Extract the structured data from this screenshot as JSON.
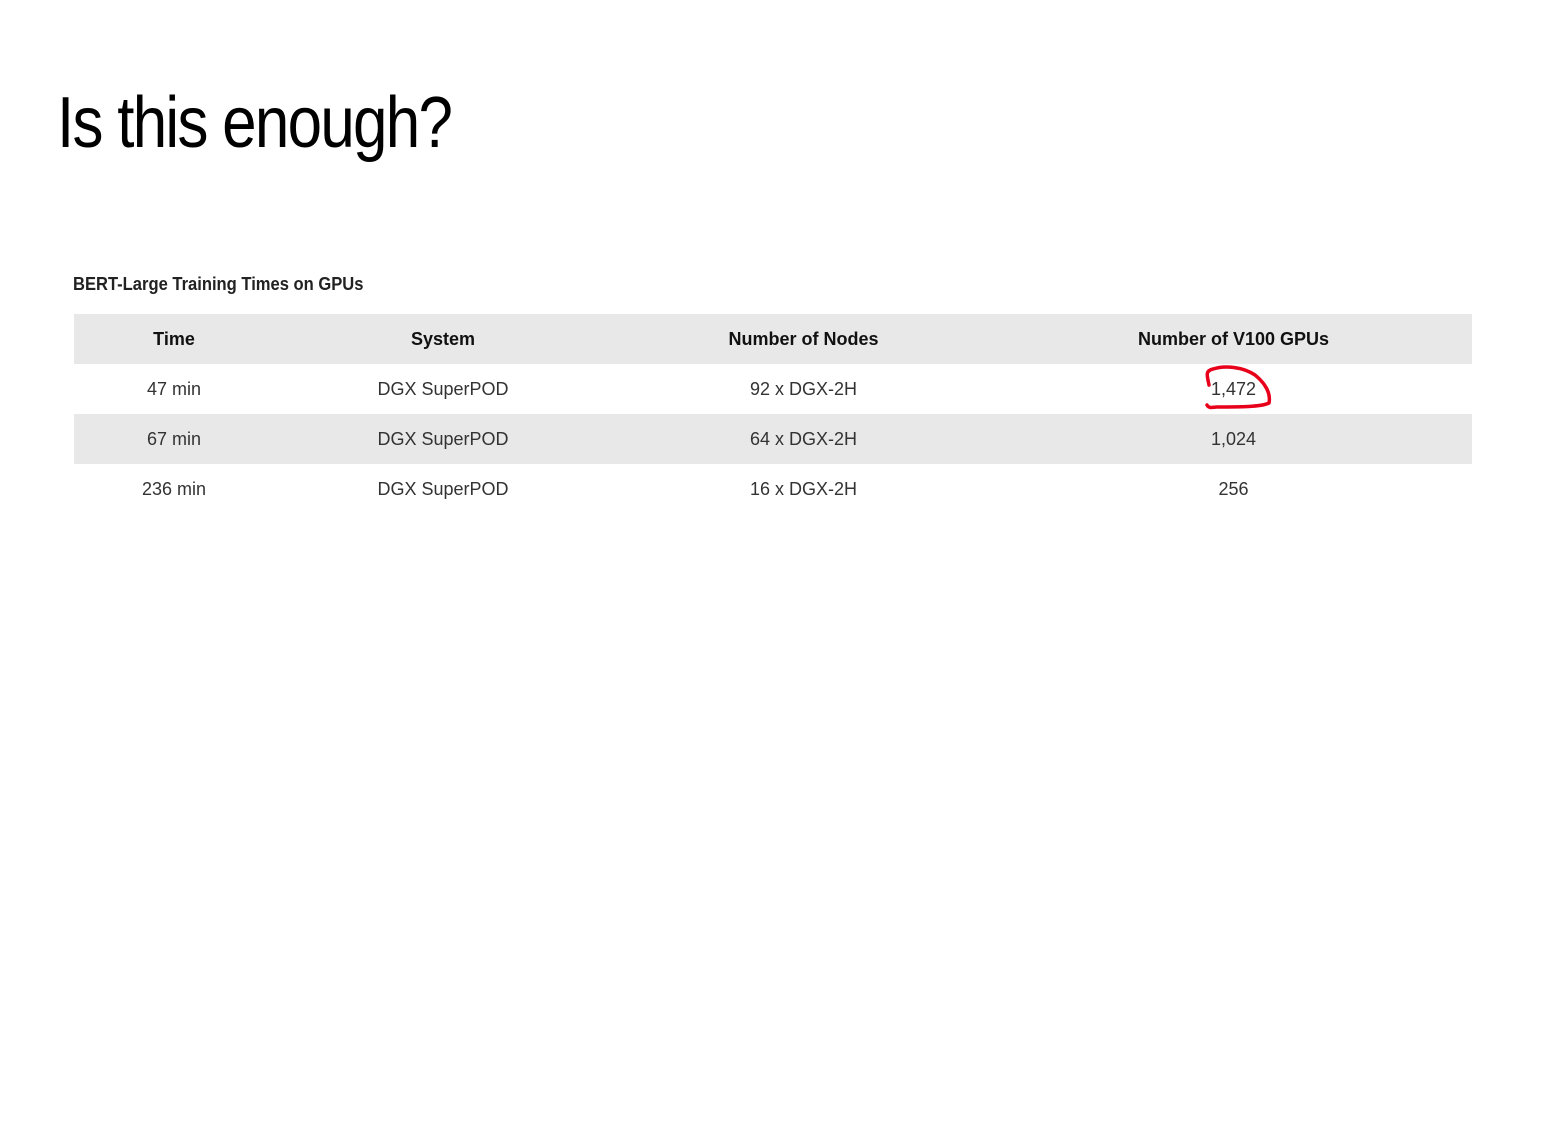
{
  "slide": {
    "title": "Is this enough?"
  },
  "table": {
    "caption": "BERT-Large Training Times on GPUs",
    "headers": [
      "Time",
      "System",
      "Number of Nodes",
      "Number of V100 GPUs"
    ],
    "rows": [
      [
        "47 min",
        "DGX SuperPOD",
        "92 x DGX-2H",
        "1,472"
      ],
      [
        "67 min",
        "DGX SuperPOD",
        "64 x DGX-2H",
        "1,024"
      ],
      [
        "236 min",
        "DGX SuperPOD",
        "16 x DGX-2H",
        "256"
      ]
    ],
    "highlight_color": "#e8001a"
  }
}
